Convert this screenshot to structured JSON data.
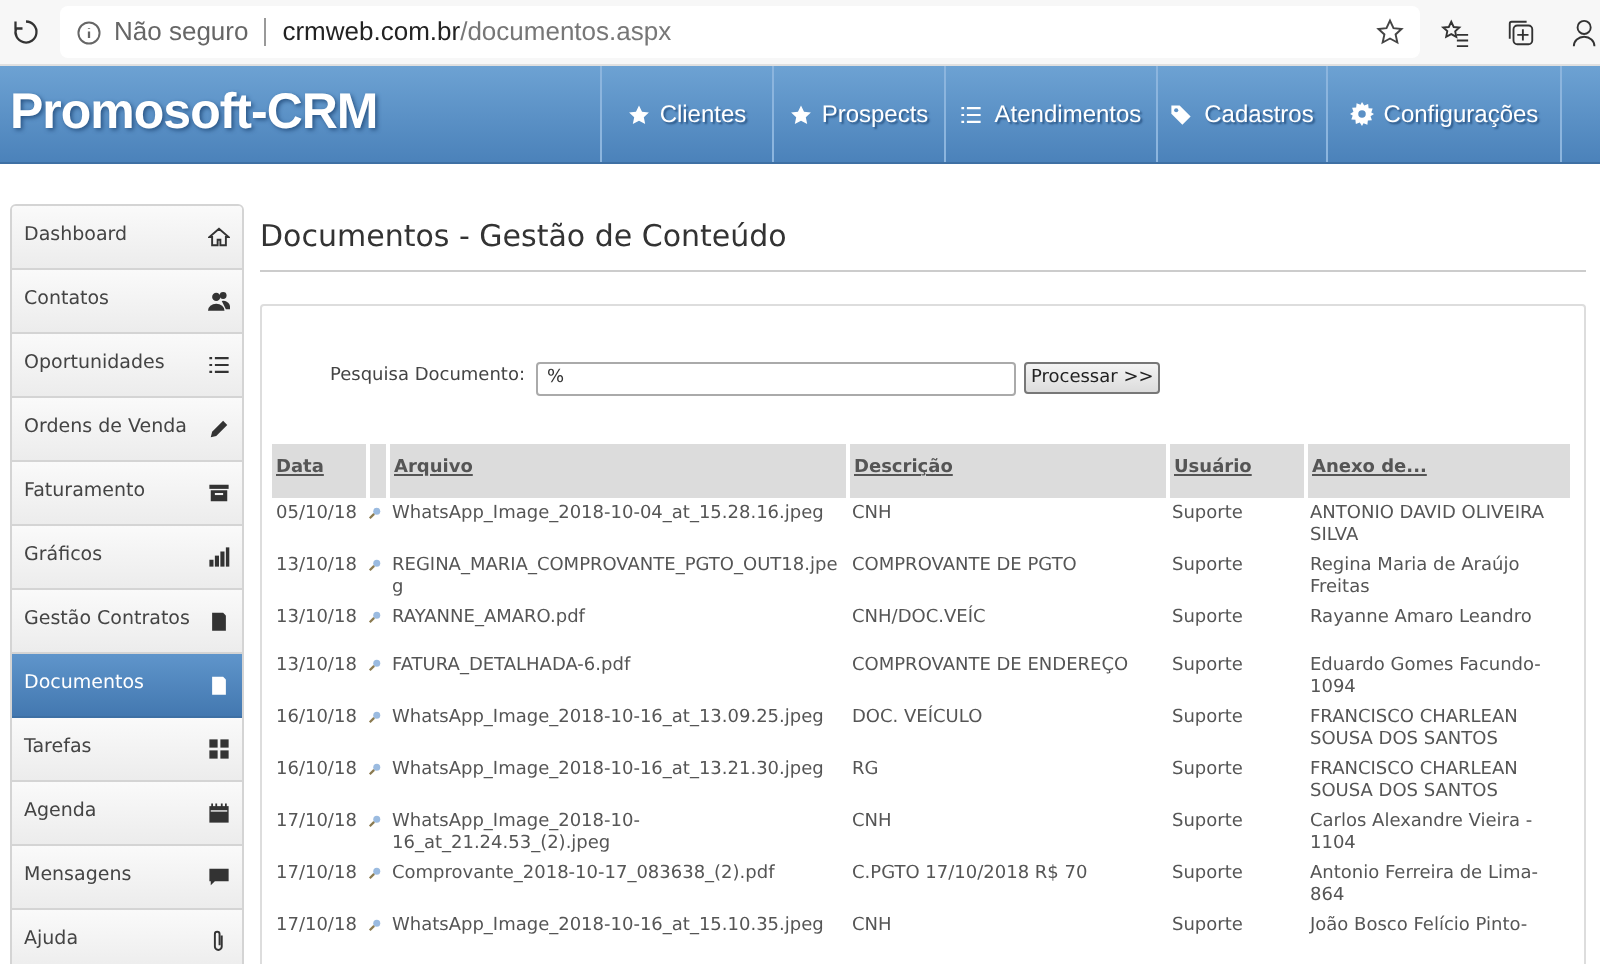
{
  "browser": {
    "security": "Não seguro",
    "url_host": "crmweb.com.br",
    "url_path": "/documentos.aspx"
  },
  "header": {
    "logo": "Promosoft-CRM",
    "nav": [
      {
        "label": "Clientes"
      },
      {
        "label": "Prospects"
      },
      {
        "label": "Atendimentos"
      },
      {
        "label": "Cadastros"
      },
      {
        "label": "Configurações"
      }
    ]
  },
  "sidebar": {
    "items": [
      {
        "label": "Dashboard",
        "selected": false
      },
      {
        "label": "Contatos",
        "selected": false
      },
      {
        "label": "Oportunidades",
        "selected": false
      },
      {
        "label": "Ordens de Venda",
        "selected": false
      },
      {
        "label": "Faturamento",
        "selected": false
      },
      {
        "label": "Gráficos",
        "selected": false
      },
      {
        "label": "Gestão Contratos",
        "selected": false
      },
      {
        "label": "Documentos",
        "selected": true
      },
      {
        "label": "Tarefas",
        "selected": false
      },
      {
        "label": "Agenda",
        "selected": false
      },
      {
        "label": "Mensagens",
        "selected": false
      },
      {
        "label": "Ajuda",
        "selected": false
      }
    ]
  },
  "page_title": "Documentos - Gestão de Conteúdo",
  "search": {
    "label": "Pesquisa Documento:",
    "value": "%",
    "button": "Processar >>"
  },
  "table": {
    "columns": [
      "Data",
      "Arquivo",
      "Descrição",
      "Usuário",
      "Anexo de..."
    ],
    "rows": [
      {
        "date": "05/10/18",
        "file": "WhatsApp_Image_2018-10-04_at_15.28.16.jpeg",
        "description": "CNH",
        "user": "Suporte",
        "attached_to": "ANTONIO DAVID OLIVEIRA SILVA"
      },
      {
        "date": "13/10/18",
        "file": "REGINA_MARIA_COMPROVANTE_PGTO_OUT18.jpeg",
        "description": "COMPROVANTE DE PGTO",
        "user": "Suporte",
        "attached_to": "Regina Maria de Araújo Freitas"
      },
      {
        "date": "13/10/18",
        "file": "RAYANNE_AMARO.pdf",
        "description": "CNH/DOC.VEÍC",
        "user": "Suporte",
        "attached_to": "Rayanne Amaro Leandro"
      },
      {
        "date": "13/10/18",
        "file": "FATURA_DETALHADA-6.pdf",
        "description": "COMPROVANTE DE ENDEREÇO",
        "user": "Suporte",
        "attached_to": "Eduardo Gomes Facundo-1094"
      },
      {
        "date": "16/10/18",
        "file": "WhatsApp_Image_2018-10-16_at_13.09.25.jpeg",
        "description": "DOC. VEÍCULO",
        "user": "Suporte",
        "attached_to": "FRANCISCO CHARLEAN SOUSA DOS SANTOS"
      },
      {
        "date": "16/10/18",
        "file": "WhatsApp_Image_2018-10-16_at_13.21.30.jpeg",
        "description": "RG",
        "user": "Suporte",
        "attached_to": "FRANCISCO CHARLEAN SOUSA DOS SANTOS"
      },
      {
        "date": "17/10/18",
        "file": "WhatsApp_Image_2018-10-16_at_21.24.53_(2).jpeg",
        "description": "CNH",
        "user": "Suporte",
        "attached_to": "Carlos Alexandre Vieira - 1104"
      },
      {
        "date": "17/10/18",
        "file": "Comprovante_2018-10-17_083638_(2).pdf",
        "description": "C.PGTO 17/10/2018 R$ 70",
        "user": "Suporte",
        "attached_to": "Antonio Ferreira de Lima-864"
      },
      {
        "date": "17/10/18",
        "file": "WhatsApp_Image_2018-10-16_at_15.10.35.jpeg",
        "description": "CNH",
        "user": "Suporte",
        "attached_to": "João Bosco Felício Pinto-"
      }
    ]
  }
}
